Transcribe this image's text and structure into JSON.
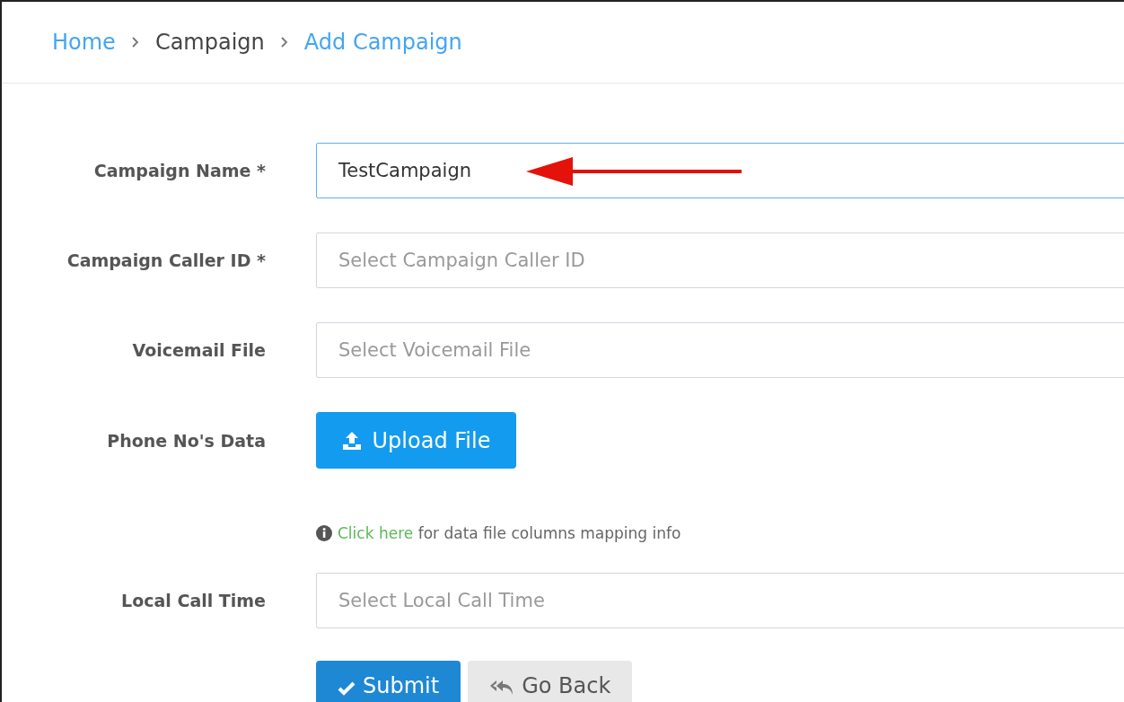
{
  "breadcrumb": [
    {
      "label": "Home",
      "link": true
    },
    {
      "label": "Campaign",
      "link": false
    },
    {
      "label": "Add Campaign",
      "link": true
    }
  ],
  "form": {
    "rows": [
      {
        "kind": "input",
        "label": "Campaign Name *",
        "value": "TestCampaign",
        "focused": true,
        "annotated": true
      },
      {
        "kind": "input",
        "label": "Campaign Caller ID *",
        "placeholder": "Select Campaign Caller ID",
        "focused": false,
        "annotated": false
      },
      {
        "kind": "input",
        "label": "Voicemail File",
        "placeholder": "Select Voicemail File",
        "focused": false,
        "annotated": false
      },
      {
        "kind": "upload",
        "label": "Phone No's Data",
        "button": "Upload File"
      },
      {
        "kind": "info",
        "link": "Click here",
        "text": "for data file columns mapping info"
      },
      {
        "kind": "input",
        "label": "Local Call Time",
        "placeholder": "Select Local Call Time",
        "focused": false,
        "annotated": false
      }
    ],
    "actions": [
      {
        "kind": "submit",
        "label": "Submit"
      },
      {
        "kind": "back",
        "label": "Go Back"
      }
    ]
  }
}
